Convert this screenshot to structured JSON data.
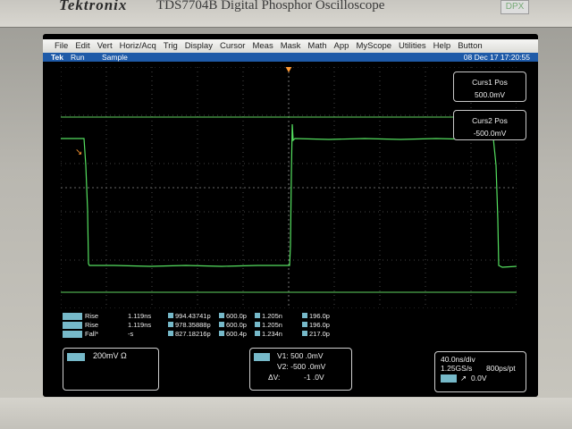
{
  "device": {
    "brand": "Tektronix",
    "model": "TDS7704B Digital Phosphor Oscilloscope",
    "badge": "DPX"
  },
  "menu": {
    "items": [
      "File",
      "Edit",
      "Vert",
      "Horiz/Acq",
      "Trig",
      "Display",
      "Cursor",
      "Meas",
      "Mask",
      "Math",
      "App",
      "MyScope",
      "Utilities",
      "Help",
      "Button"
    ]
  },
  "status": {
    "brand": "Tek",
    "state": "Run",
    "mode": "Sample",
    "datetime": "08 Dec 17 17:20:55"
  },
  "cursor_readouts": {
    "curs1": {
      "title": "Curs1 Pos",
      "value": "500.0mV"
    },
    "curs2": {
      "title": "Curs2 Pos",
      "value": "-500.0mV"
    }
  },
  "measurements": [
    {
      "label": "Rise",
      "value": "1.119ns",
      "mean": "994.43741p",
      "min": "600.0p",
      "max": "1.205n",
      "std": "196.0p"
    },
    {
      "label": "Rise",
      "value": "1.119ns",
      "mean": "978.35888p",
      "min": "600.0p",
      "max": "1.205n",
      "std": "196.0p"
    },
    {
      "label": "Fall*",
      "value": "-s",
      "mean": "827.18216p",
      "min": "600.4p",
      "max": "1.234n",
      "std": "217.0p"
    }
  ],
  "channel": {
    "scale": "200mV Ω"
  },
  "cursor_box": {
    "v1": "V1: 500 .0mV",
    "v2": "V2: -500 .0mV",
    "dv_label": "ΔV:",
    "dv_value": "-1 .0V"
  },
  "timebase": {
    "horiz": "40.0ns/div",
    "rate": "1.25GS/s",
    "resolution": "800ps/pt",
    "trigger_symbol": "↗",
    "trigger_level": "0.0V"
  },
  "markers": {
    "ch1": "1",
    "trigger": "T"
  },
  "colors": {
    "trace": "#55e060",
    "cursor_line": "#5fd35f",
    "status_bar": "#1e5aa8",
    "measurement_chip": "#76b9c9",
    "trigger_marker": "#ff9933"
  }
}
